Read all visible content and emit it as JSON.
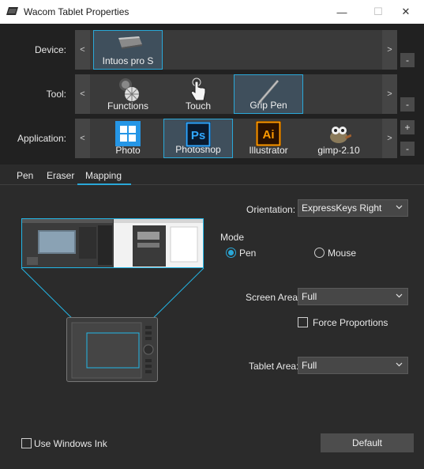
{
  "window": {
    "title": "Wacom Tablet Properties",
    "min_glyph": "—",
    "max_glyph": "☐",
    "close_glyph": "✕"
  },
  "device": {
    "label": "Device:",
    "items": [
      {
        "label": "Intuos pro S",
        "icon": "tablet-icon",
        "selected": true
      }
    ],
    "remove_button": "-"
  },
  "tool": {
    "label": "Tool:",
    "items": [
      {
        "label": "Functions",
        "icon": "functions-icon",
        "selected": false
      },
      {
        "label": "Touch",
        "icon": "touch-hand-icon",
        "selected": false
      },
      {
        "label": "Grip Pen",
        "icon": "pen-icon",
        "selected": true
      }
    ],
    "remove_button": "-"
  },
  "application": {
    "label": "Application:",
    "items": [
      {
        "label": "Photo",
        "icon": "windows-photo-icon",
        "selected": false
      },
      {
        "label": "Photoshop",
        "icon": "photoshop-icon",
        "selected": true
      },
      {
        "label": "Illustrator",
        "icon": "illustrator-icon",
        "selected": false
      },
      {
        "label": "gimp-2.10",
        "icon": "gimp-icon",
        "selected": false
      }
    ],
    "add_button": "+",
    "remove_button": "-"
  },
  "arrows": {
    "left": "<",
    "right": ">"
  },
  "tabs": [
    {
      "label": "Pen",
      "active": false
    },
    {
      "label": "Eraser",
      "active": false
    },
    {
      "label": "Mapping",
      "active": true
    }
  ],
  "mapping": {
    "orientation_label": "Orientation:",
    "orientation_value": "ExpressKeys Right",
    "mode_label": "Mode",
    "mode_pen": "Pen",
    "mode_mouse": "Mouse",
    "mode_selected": "Pen",
    "screen_area_label": "Screen Area:",
    "screen_area_value": "Full",
    "force_proportions": "Force Proportions",
    "force_proportions_checked": false,
    "tablet_area_label": "Tablet Area:",
    "tablet_area_value": "Full",
    "use_windows_ink": "Use Windows Ink",
    "use_windows_ink_checked": false,
    "default_button": "Default"
  },
  "colors": {
    "accent": "#2aa8d8",
    "background": "#2b2b2b",
    "panel": "#212121"
  }
}
